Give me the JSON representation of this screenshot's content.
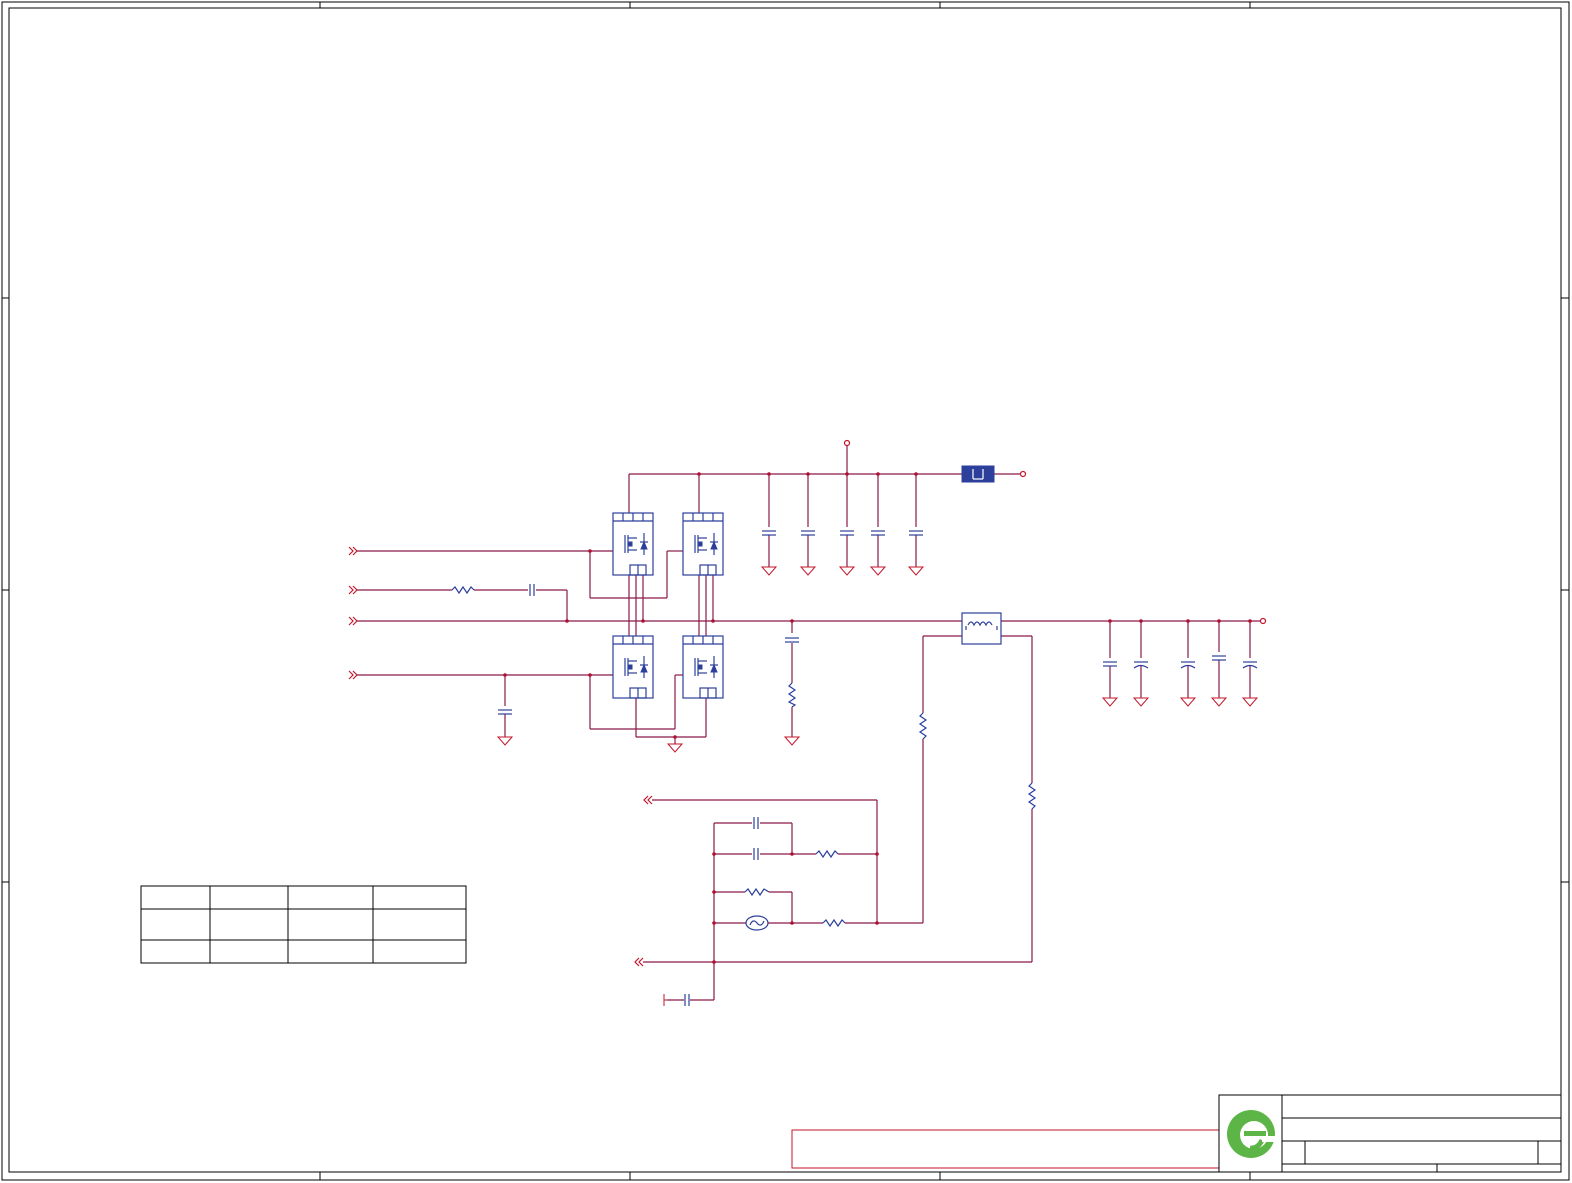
{
  "sheet": {
    "title": "",
    "colors": {
      "wire": "#c4162a",
      "component": "#2c3f9a",
      "frame": "#000000",
      "logo": "#5cb546"
    }
  },
  "logo": {
    "icon": "green-e-logo-icon"
  },
  "title_block": {
    "title": "",
    "doc_number": "",
    "revision": "",
    "sheet": ""
  },
  "notes_box": {
    "text": ""
  },
  "info_table": {
    "rows": [
      [
        "",
        "",
        "",
        ""
      ],
      [
        "",
        "",
        "",
        ""
      ],
      [
        "",
        "",
        "",
        ""
      ]
    ]
  }
}
